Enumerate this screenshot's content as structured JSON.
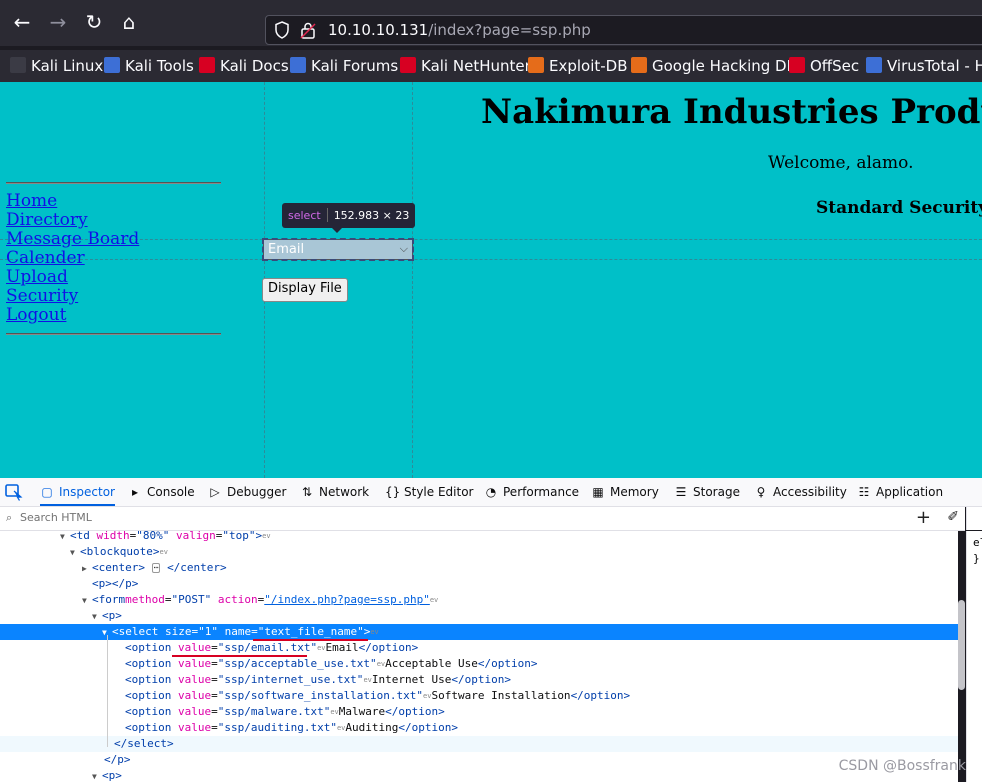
{
  "browser": {
    "url_host": "10.10.10.131",
    "url_path": "/index?page=ssp.php",
    "bookmarks": [
      {
        "label": "Kali Linux",
        "color": "#2b2a33"
      },
      {
        "label": "Kali Tools",
        "color": "#e06c75"
      },
      {
        "label": "Kali Docs",
        "color": "#d70022"
      },
      {
        "label": "Kali Forums",
        "color": "#3d6fd6"
      },
      {
        "label": "Kali NetHunter",
        "color": "#d70022"
      },
      {
        "label": "Exploit-DB",
        "color": "#e56c1a"
      },
      {
        "label": "Google Hacking DB",
        "color": "#e56c1a"
      },
      {
        "label": "OffSec",
        "color": "#d70022"
      },
      {
        "label": "VirusTotal - Ho",
        "color": "#3d6fd6"
      }
    ]
  },
  "page": {
    "title": "Nakimura Industries Produc",
    "welcome": "Welcome, alamo.",
    "section": "Standard Security",
    "nav": [
      "Home",
      "Directory",
      "Message Board",
      "Calender",
      "Upload",
      "Security",
      "Logout"
    ],
    "select_value": "Email",
    "button_label": "Display File",
    "tooltip_tag": "select",
    "tooltip_dims": "152.983 × 23"
  },
  "devtools": {
    "tabs": [
      "Inspector",
      "Console",
      "Debugger",
      "Network",
      "Style Editor",
      "Performance",
      "Memory",
      "Storage",
      "Accessibility",
      "Application"
    ],
    "search_placeholder": "Search HTML",
    "sidebar_lines": [
      "el",
      "}"
    ]
  },
  "markup_lines": {
    "td": {
      "tag": "<td",
      "attrs": [
        [
          "width",
          "\"80%\""
        ],
        [
          "valign",
          "\"top\""
        ]
      ],
      "close": ">"
    },
    "blockquote": "<blockquote>",
    "center_open": "<center>",
    "center_close": "</center>",
    "p_open": "<p>",
    "p_close": "</p>",
    "form": {
      "tag": "<form",
      "attrs": [
        [
          "method",
          "\"POST\""
        ],
        [
          "action",
          "\"/index.php?page=ssp.php\""
        ]
      ],
      "close": ">"
    },
    "p2_open": "<p>",
    "select": {
      "tag": "<select",
      "attrs": [
        [
          "size",
          "\"1\""
        ],
        [
          "name",
          "\"text_file_name\""
        ]
      ],
      "close": ">"
    },
    "options": [
      {
        "value": "\"ssp/email.txt\"",
        "text": "Email"
      },
      {
        "value": "\"ssp/acceptable_use.txt\"",
        "text": "Acceptable Use"
      },
      {
        "value": "\"ssp/internet_use.txt\"",
        "text": "Internet Use"
      },
      {
        "value": "\"ssp/software_installation.txt\"",
        "text": "Software Installation"
      },
      {
        "value": "\"ssp/malware.txt\"",
        "text": "Malware"
      },
      {
        "value": "\"ssp/auditing.txt\"",
        "text": "Auditing"
      }
    ],
    "select_close": "</select>",
    "p2_close": "</p>",
    "p3_open": "<p>"
  },
  "watermark": "CSDN @Bossfrank"
}
